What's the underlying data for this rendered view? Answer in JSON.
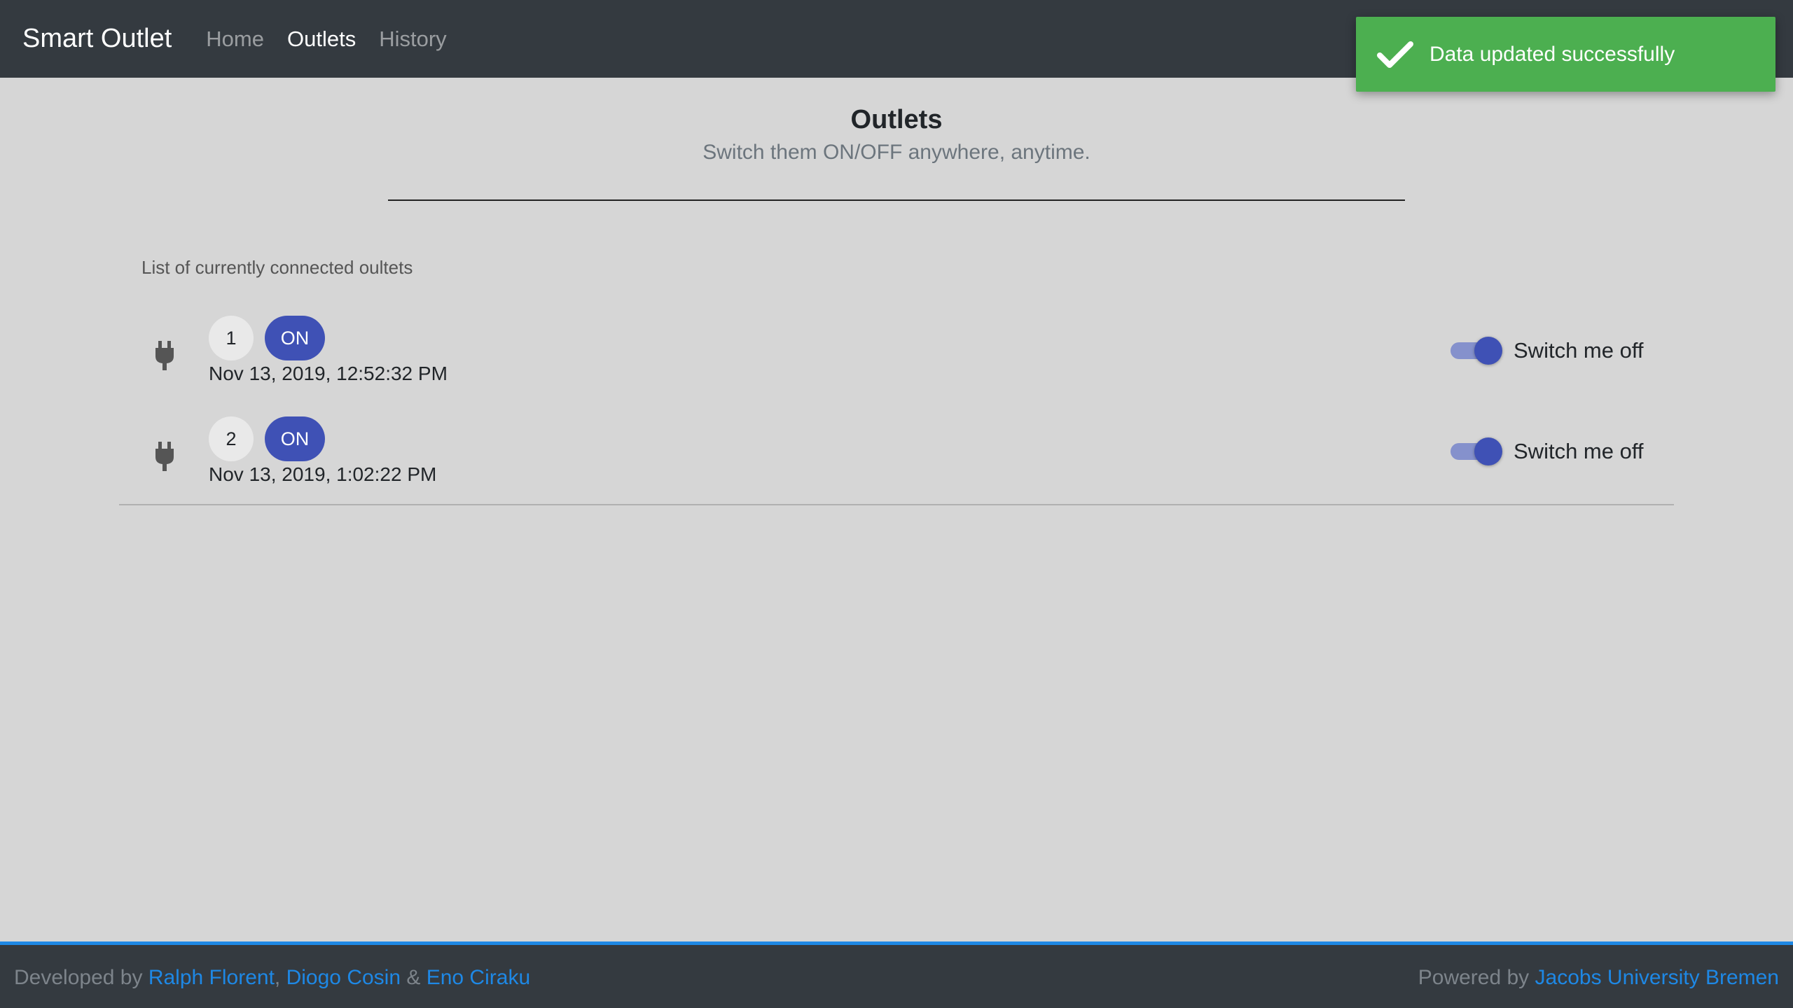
{
  "navbar": {
    "brand": "Smart Outlet",
    "links": [
      "Home",
      "Outlets",
      "History"
    ],
    "active": "Outlets"
  },
  "toast": {
    "icon": "check-icon",
    "message": "Data updated successfully",
    "color": "#4caf50"
  },
  "page": {
    "title": "Outlets",
    "subtitle": "Switch them ON/OFF anywhere, anytime."
  },
  "list": {
    "header": "List of currently connected oultets",
    "items": [
      {
        "number": "1",
        "status": "ON",
        "timestamp": "Nov 13, 2019, 12:52:32 PM",
        "toggle_on": true,
        "toggle_label": "Switch me off",
        "icon": "power-plug-icon"
      },
      {
        "number": "2",
        "status": "ON",
        "timestamp": "Nov 13, 2019, 1:02:22 PM",
        "toggle_on": true,
        "toggle_label": "Switch me off",
        "icon": "power-plug-icon"
      }
    ]
  },
  "footer": {
    "developed_by": "Developed by",
    "dev1": "Ralph Florent",
    "comma": ",",
    "dev2": "Diogo Cosin",
    "amp": "&",
    "dev3": "Eno Ciraku",
    "powered_by": "Powered by",
    "org": "Jacobs University Bremen"
  },
  "colors": {
    "navbar_bg": "#343a40",
    "accent": "#3f51b5",
    "link": "#1e88e5",
    "success": "#4caf50"
  }
}
